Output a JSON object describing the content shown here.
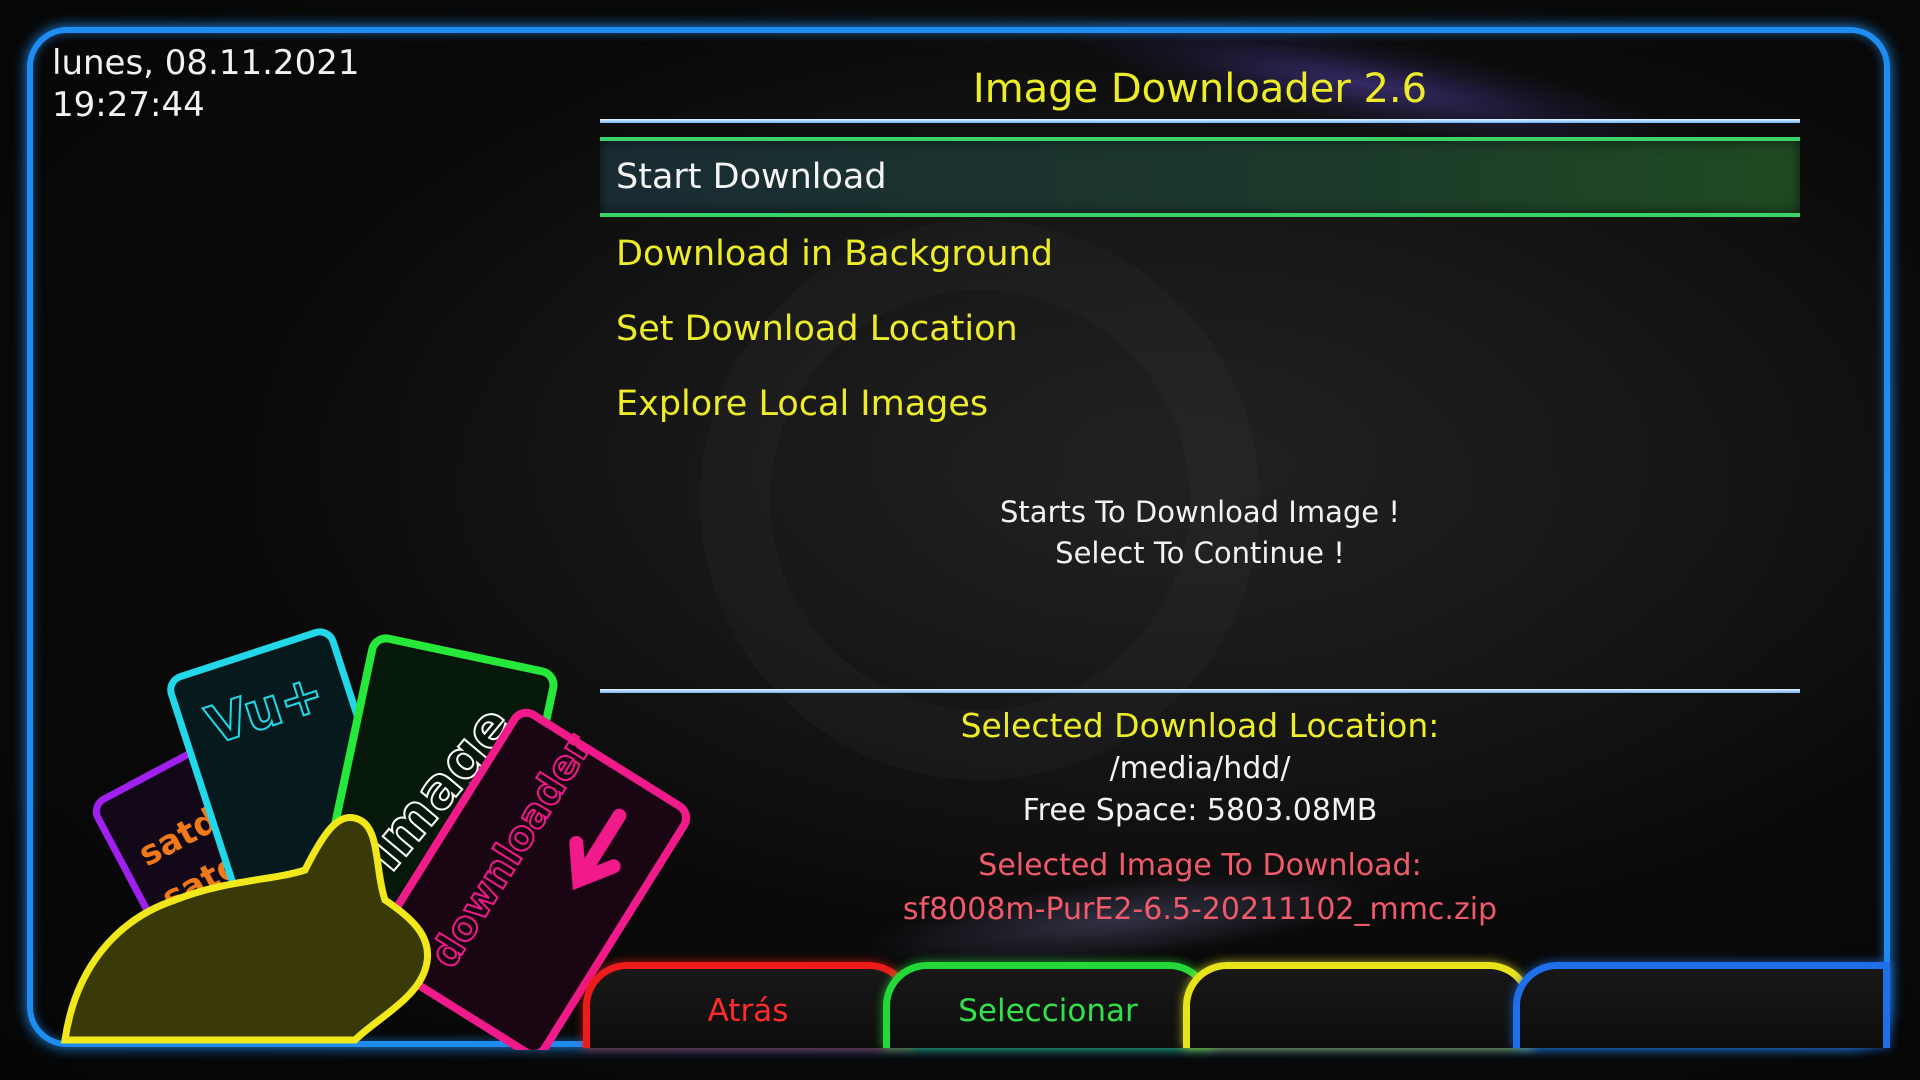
{
  "header": {
    "date": "lunes, 08.11.2021",
    "time": "19:27:44",
    "title": "Image Downloader 2.6"
  },
  "menu": {
    "items": [
      {
        "label": "Start Download",
        "selected": true
      },
      {
        "label": "Download in Background",
        "selected": false
      },
      {
        "label": "Set Download Location",
        "selected": false
      },
      {
        "label": "Explore Local Images",
        "selected": false
      }
    ]
  },
  "description": {
    "line1": "Starts To Download Image !",
    "line2": "Select To Continue !"
  },
  "info": {
    "location_label": "Selected Download Location:",
    "location_value": "/media/hdd/",
    "free_space": "Free Space: 5803.08MB",
    "image_label": "Selected Image To Download:",
    "image_value": "sf8008m-PurE2-6.5-20211102_mmc.zip"
  },
  "buttons": {
    "red": "Atrás",
    "green": "Seleccionar",
    "yellow": "",
    "blue": ""
  },
  "logo": {
    "card_vu": "Vu+",
    "card_image": "image",
    "card_downloader": "downloader",
    "card_satdream": "satdreamgr"
  },
  "colors": {
    "accent_yellow": "#ecec28",
    "frame_blue": "#1e8cf0",
    "selection_green": "#3ad36a",
    "red_key": "#ee1b1b",
    "green_key": "#25d83a",
    "yellow_key": "#e8e41a",
    "blue_key": "#1e6fe8"
  }
}
